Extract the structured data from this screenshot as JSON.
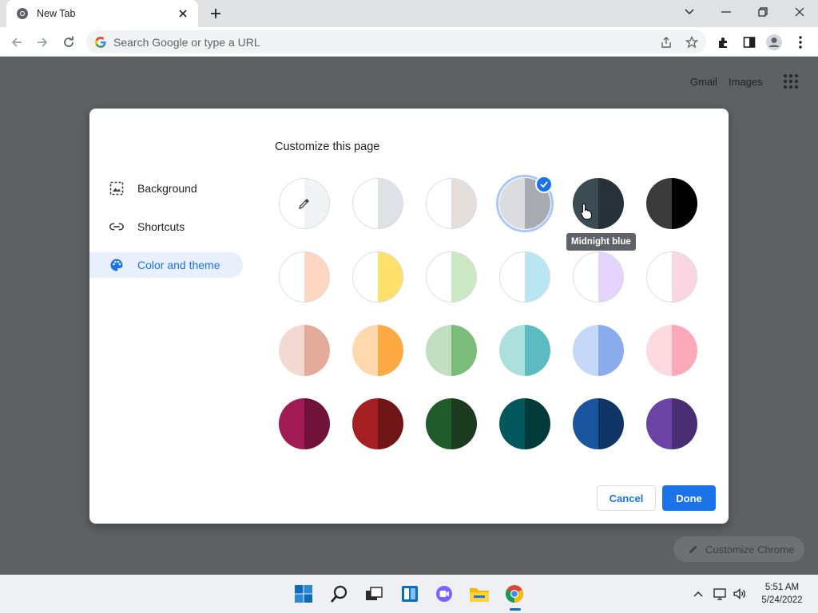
{
  "browser": {
    "tab_title": "New Tab",
    "omnibox_placeholder": "Search Google or type a URL"
  },
  "ntp": {
    "gmail_label": "Gmail",
    "images_label": "Images",
    "customize_chrome_label": "Customize Chrome"
  },
  "dialog": {
    "title": "Customize this page",
    "sidebar": [
      {
        "label": "Background",
        "icon": "image-icon"
      },
      {
        "label": "Shortcuts",
        "icon": "link-icon"
      },
      {
        "label": "Color and theme",
        "icon": "palette-icon",
        "active": true
      }
    ],
    "tooltip": "Midnight blue",
    "cancel_label": "Cancel",
    "done_label": "Done",
    "swatches": [
      [
        {
          "l": "#ffffff",
          "r": "#f1f3f4",
          "type": "custom"
        },
        {
          "l": "#ffffff",
          "r": "#dee1e6"
        },
        {
          "l": "#ffffff",
          "r": "#e5dedb"
        },
        {
          "l": "#dadce0",
          "r": "#a8abb2",
          "selected": true
        },
        {
          "l": "#3c4c55",
          "r": "#283137"
        },
        {
          "l": "#3b3b3c",
          "r": "#000000"
        }
      ],
      [
        {
          "l": "#ffffff",
          "r": "#fdd7c2"
        },
        {
          "l": "#ffffff",
          "r": "#fee06a"
        },
        {
          "l": "#ffffff",
          "r": "#cce8c4"
        },
        {
          "l": "#ffffff",
          "r": "#b9e6f2"
        },
        {
          "l": "#ffffff",
          "r": "#e4d3fd"
        },
        {
          "l": "#ffffff",
          "r": "#f9d6e2"
        }
      ],
      [
        {
          "l": "#f2d9d1",
          "r": "#e3ab99"
        },
        {
          "l": "#fed9ad",
          "r": "#fdaa45"
        },
        {
          "l": "#c2e0c1",
          "r": "#7bbc7b"
        },
        {
          "l": "#ace0dd",
          "r": "#5cbac1"
        },
        {
          "l": "#c6d8fa",
          "r": "#8aabec"
        },
        {
          "l": "#fdd9e0",
          "r": "#fba9b8"
        }
      ],
      [
        {
          "l": "#a01a55",
          "r": "#701239"
        },
        {
          "l": "#a51e21",
          "r": "#711616"
        },
        {
          "l": "#205c2b",
          "r": "#1b3a1e"
        },
        {
          "l": "#02585c",
          "r": "#02393b"
        },
        {
          "l": "#1a56a0",
          "r": "#0f3566"
        },
        {
          "l": "#6b43a5",
          "r": "#4a2e73"
        }
      ]
    ]
  },
  "taskbar": {
    "time": "5:51 AM",
    "date": "5/24/2022"
  },
  "colors": {
    "accent": "#1a73e8",
    "overlay": "#5e6061"
  }
}
